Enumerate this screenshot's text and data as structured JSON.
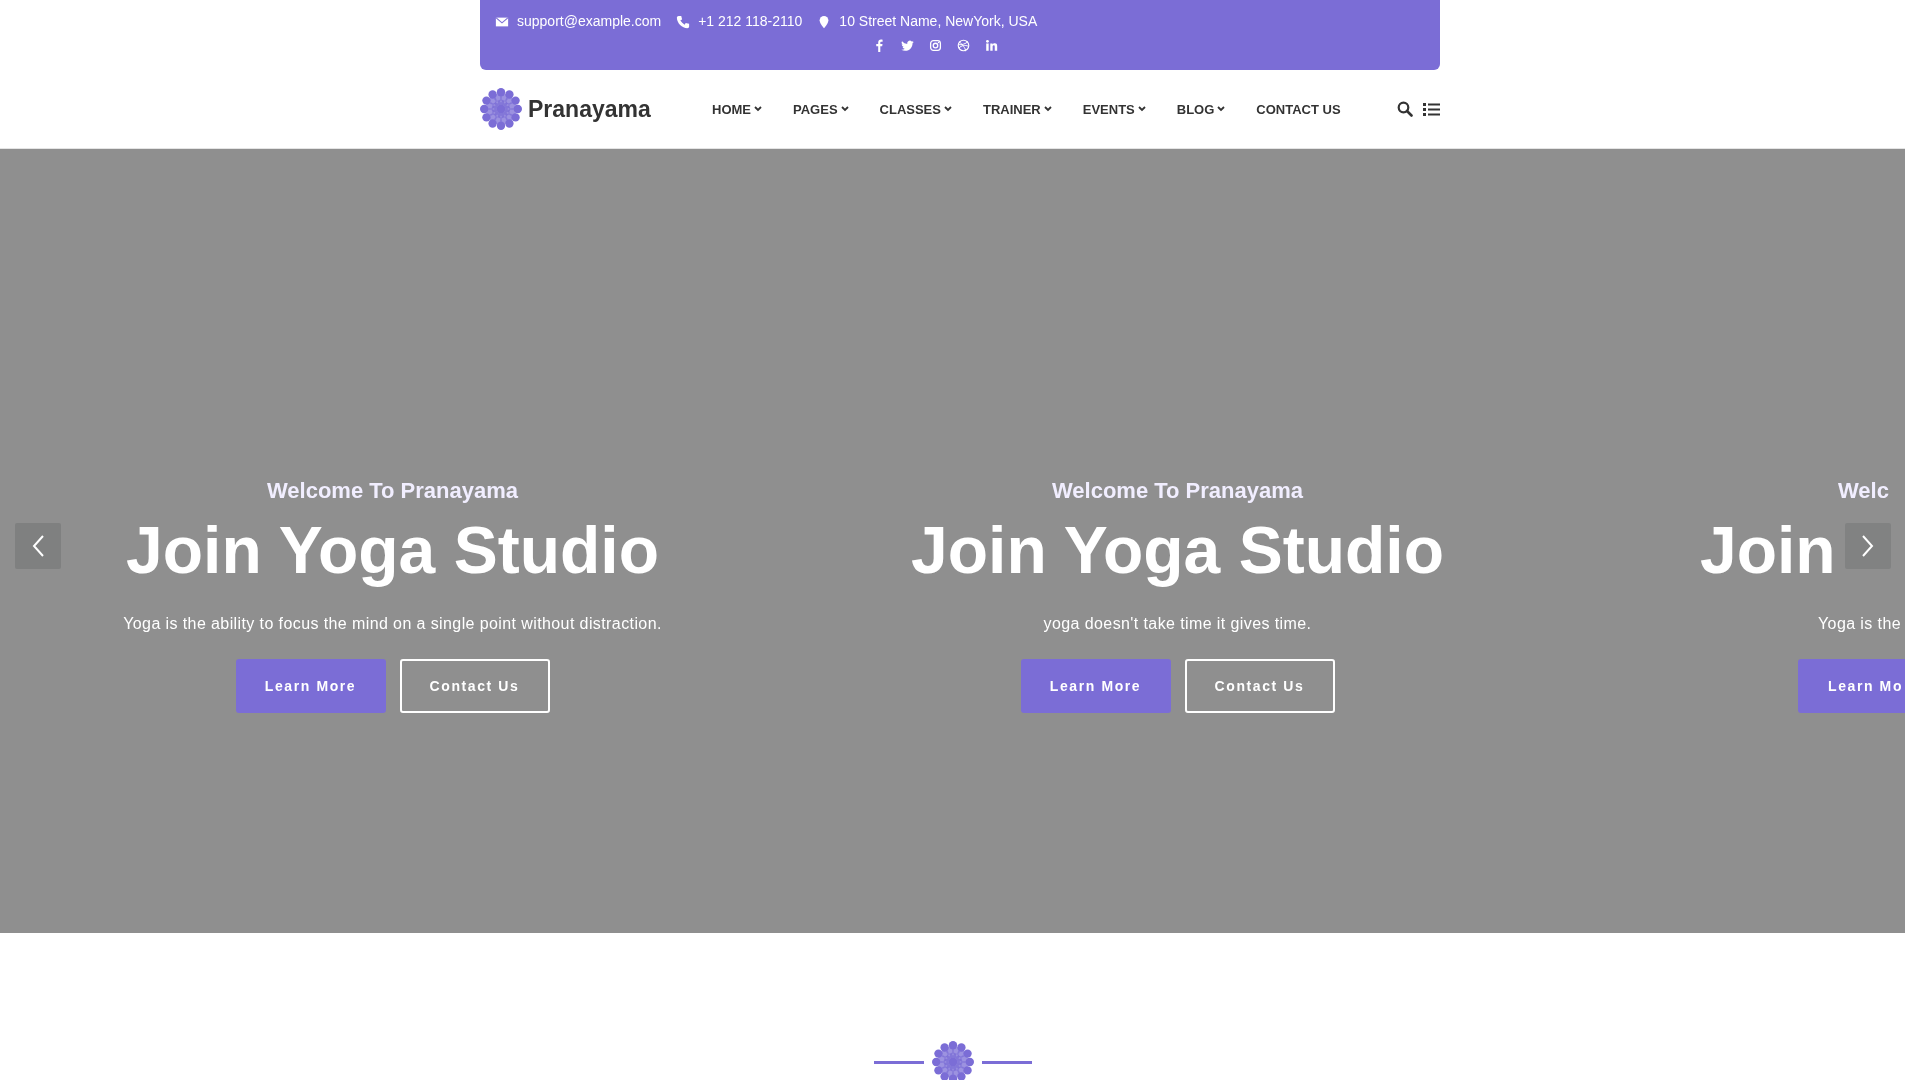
{
  "top_bar": {
    "contacts": [
      {
        "kind": "email",
        "text": "support@example.com"
      },
      {
        "kind": "phone",
        "text": "+1 212 118-2110"
      },
      {
        "kind": "location",
        "text": "10 Street Name, NewYork, USA"
      }
    ]
  },
  "header": {
    "logo": "Pranayama",
    "menu": [
      {
        "label": "HOME",
        "dropdown": true
      },
      {
        "label": "PAGES",
        "dropdown": true
      },
      {
        "label": "CLASSES",
        "dropdown": true
      },
      {
        "label": "TRAINER",
        "dropdown": true
      },
      {
        "label": "EVENTS",
        "dropdown": true
      },
      {
        "label": "BLOG",
        "dropdown": true
      },
      {
        "label": "CONTACT US",
        "dropdown": false
      }
    ]
  },
  "slider": {
    "slides": [
      {
        "kind": "full",
        "welcome": "Welcome To Pranayama",
        "title": "Join Yoga Studio",
        "description": "Yoga is the ability to focus the mind on a single point without distraction.",
        "buttons": [
          {
            "kind": "filled",
            "label": "Learn More"
          },
          {
            "kind": "outline",
            "label": "Contact Us"
          }
        ]
      },
      {
        "kind": "full",
        "welcome": "Welcome To Pranayama",
        "title": "Join Yoga Studio",
        "description": "yoga doesn't take time it gives time.",
        "buttons": [
          {
            "kind": "filled",
            "label": "Learn More"
          },
          {
            "kind": "outline",
            "label": "Contact Us"
          }
        ]
      },
      {
        "kind": "partial",
        "welcome": "Welc",
        "title": "Join",
        "description": "Yoga is the",
        "buttons": [
          {
            "kind": "filled",
            "label": "Learn Mo"
          }
        ]
      }
    ]
  }
}
